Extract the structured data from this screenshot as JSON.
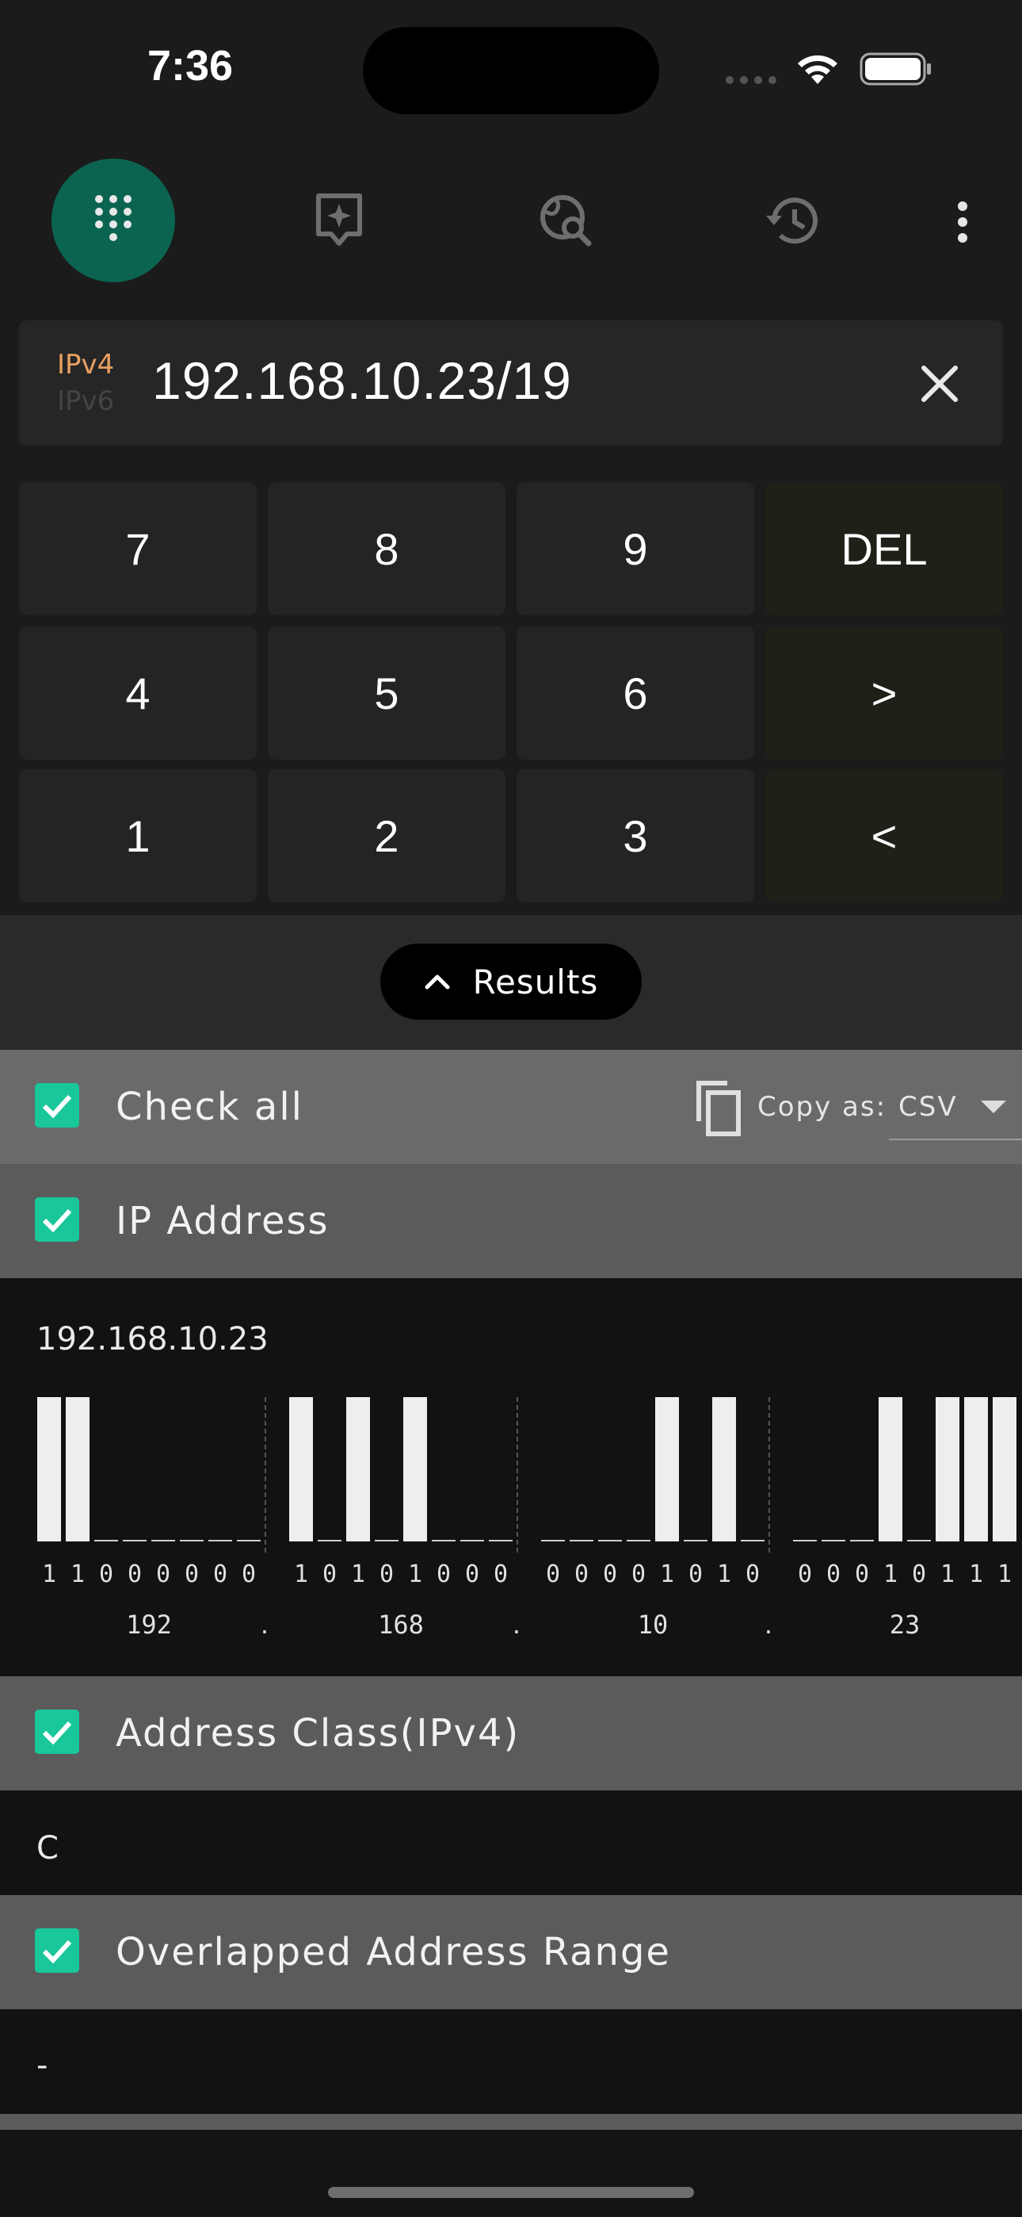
{
  "status": {
    "time": "7:36"
  },
  "toolbar": {
    "items": [
      {
        "icon": "dialpad-icon",
        "active": true
      },
      {
        "icon": "ai-sparkle-icon",
        "active": false
      },
      {
        "icon": "globe-search-icon",
        "active": false
      },
      {
        "icon": "history-icon",
        "active": false
      },
      {
        "icon": "more-vert-icon",
        "active": false
      }
    ],
    "accent": "#0b6450"
  },
  "input": {
    "version_v4": "IPv4",
    "version_v6": "IPv6",
    "value": "192.168.10.23/19"
  },
  "keypad": {
    "row1": [
      "7",
      "8",
      "9",
      "DEL"
    ],
    "row2": [
      "4",
      "5",
      "6",
      ">"
    ],
    "row3": [
      "1",
      "2",
      "3",
      "<"
    ]
  },
  "results_button": {
    "label": "Results"
  },
  "check_all": {
    "label": "Check all",
    "copy_as_label": "Copy as:",
    "format": "CSV"
  },
  "sections": {
    "ip_address": {
      "label": "IP Address",
      "value": "192.168.10.23",
      "octets": [
        {
          "decimal": "192",
          "bits": [
            1,
            1,
            0,
            0,
            0,
            0,
            0,
            0
          ]
        },
        {
          "decimal": "168",
          "bits": [
            1,
            0,
            1,
            0,
            1,
            0,
            0,
            0
          ]
        },
        {
          "decimal": "10",
          "bits": [
            0,
            0,
            0,
            0,
            1,
            0,
            1,
            0
          ]
        },
        {
          "decimal": "23",
          "bits": [
            0,
            0,
            0,
            1,
            0,
            1,
            1,
            1
          ]
        }
      ],
      "dot": "."
    },
    "address_class": {
      "label": "Address Class(IPv4)",
      "value": "C"
    },
    "overlapped": {
      "label": "Overlapped Address Range",
      "value": "-"
    }
  },
  "colors": {
    "checkbox": "#19c79a",
    "ipv4": "#e8a060"
  }
}
